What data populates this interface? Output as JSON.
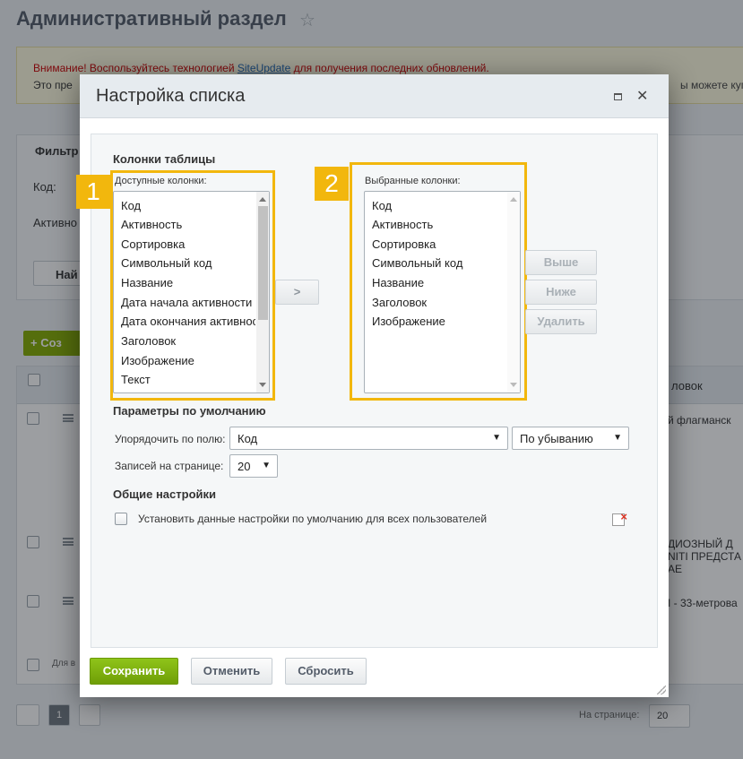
{
  "background": {
    "page_title": "Административный раздел",
    "alert": {
      "warning": "Внимание! Воспользуйтесь технологией",
      "link": "SiteUpdate",
      "warning_end": "для получения последних обновлений.",
      "line2": "Это пре",
      "line2_end": "ы можете купи"
    },
    "filter": {
      "title": "Фильтр",
      "code_label": "Код:",
      "active_label": "Активно",
      "find_button": "Най"
    },
    "create_button": "Соз",
    "table": {
      "header_col": "ловок",
      "row1": "й флагманск",
      "row2": [
        "ДИОЗНЫЙ Д",
        "NITI ПРЕДСТА",
        "АЕ"
      ],
      "row3": "I - 33-метрова",
      "footer": "Для в"
    },
    "pager": {
      "page": "1",
      "per_page_label": "На странице:",
      "per_page_value": "20"
    }
  },
  "dialog": {
    "title": "Настройка списка",
    "columns_section": "Колонки таблицы",
    "available_label": "Доступные колонки:",
    "selected_label": "Выбранные колонки:",
    "available_columns": [
      "Код",
      "Активность",
      "Сортировка",
      "Символьный код",
      "Название",
      "Дата начала активности",
      "Дата окончания активности",
      "Заголовок",
      "Изображение",
      "Текст"
    ],
    "selected_columns": [
      "Код",
      "Активность",
      "Сортировка",
      "Символьный код",
      "Название",
      "Заголовок",
      "Изображение"
    ],
    "badges": [
      "1",
      "2"
    ],
    "move_button": ">",
    "up_button": "Выше",
    "down_button": "Ниже",
    "delete_button": "Удалить",
    "defaults_section": "Параметры по умолчанию",
    "sort_label": "Упорядочить по полю:",
    "sort_field": "Код",
    "sort_order": "По убыванию",
    "per_page_label": "Записей на странице:",
    "per_page_value": "20",
    "general_section": "Общие настройки",
    "apply_all_label": "Установить данные настройки по умолчанию для всех пользователей",
    "save_button": "Сохранить",
    "cancel_button": "Отменить",
    "reset_button": "Сбросить",
    "colors": {
      "highlight": "#f2b70d",
      "save": "#7bb30e"
    }
  }
}
